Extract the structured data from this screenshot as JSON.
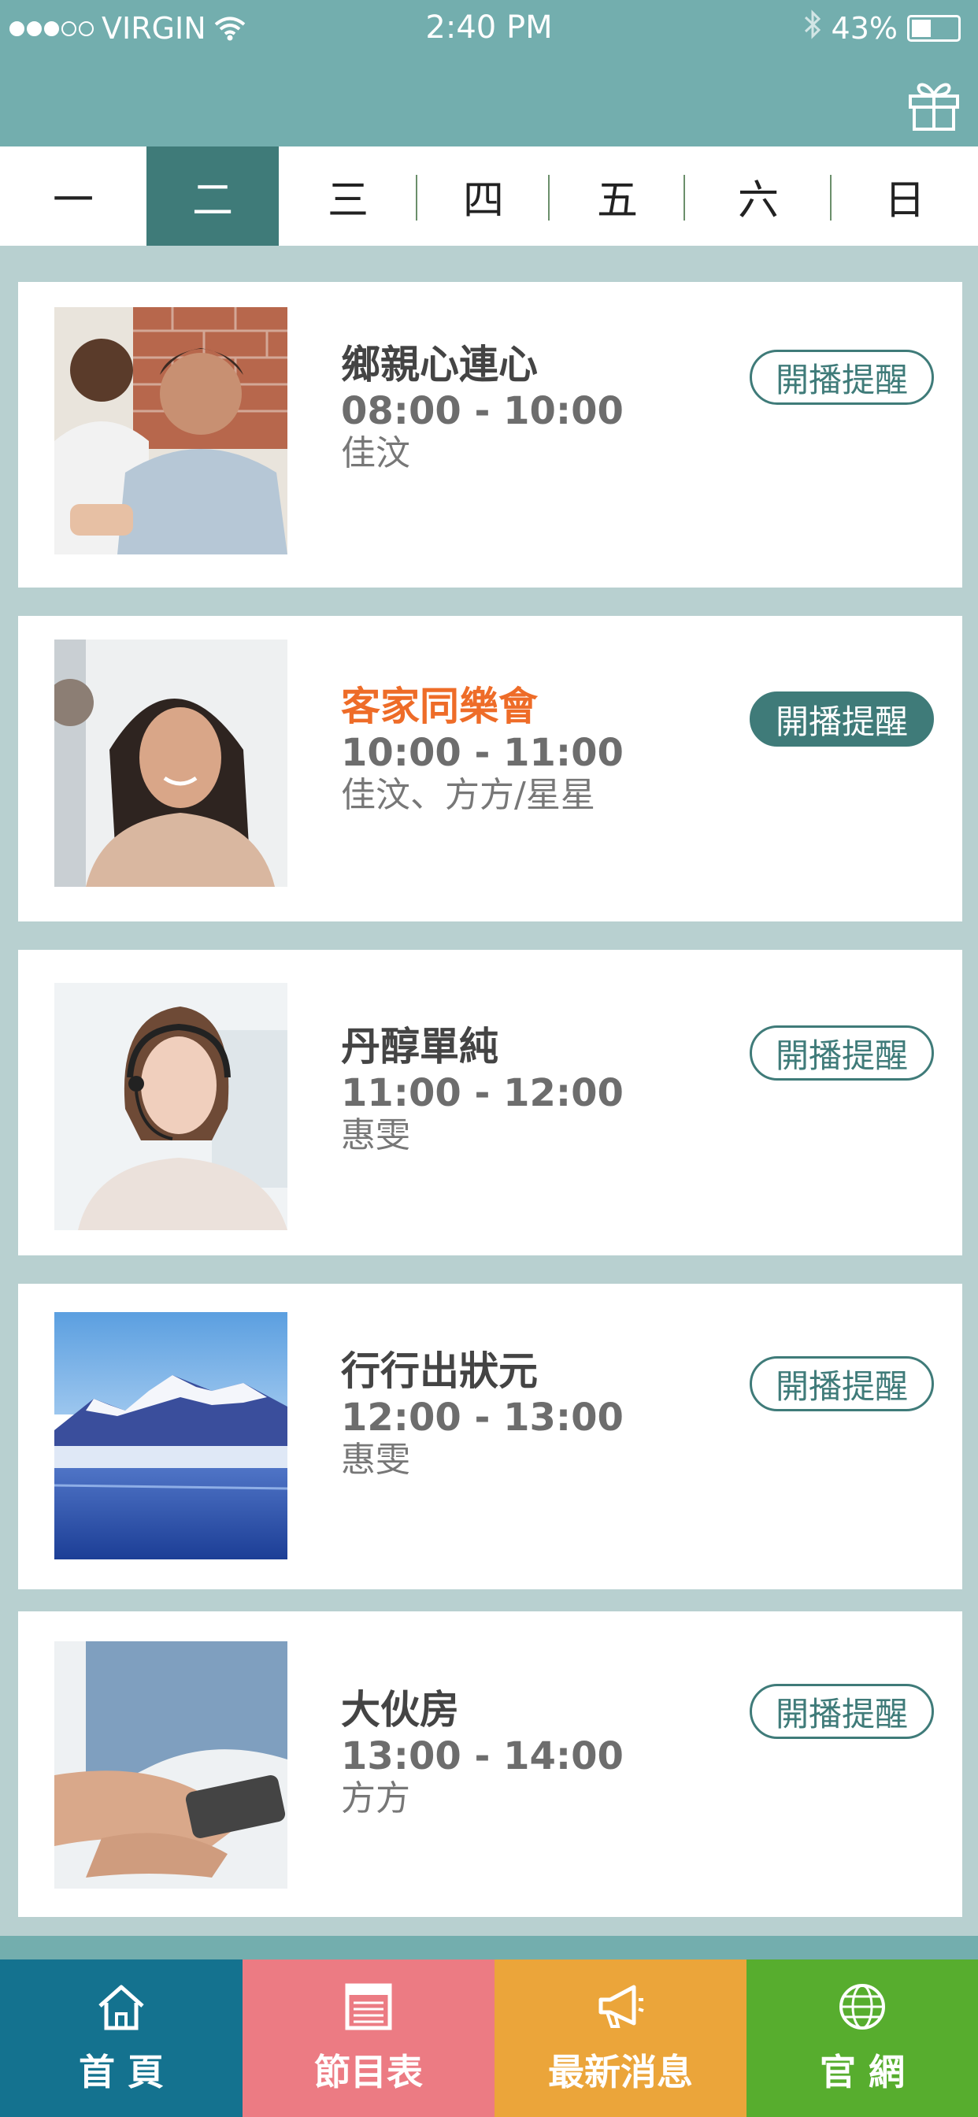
{
  "status_bar": {
    "carrier": "VIRGIN",
    "time": "2:40 PM",
    "battery": "43%",
    "battery_level": 0.43
  },
  "header": {
    "gift_icon": "gift-icon"
  },
  "days": {
    "active_index": 1,
    "items": [
      "一",
      "二",
      "三",
      "四",
      "五",
      "六",
      "日"
    ]
  },
  "programs": [
    {
      "title": "鄉親心連心",
      "time": "08:00 - 10:00",
      "host": "佳汶",
      "remind": "開播提醒",
      "remind_on": false,
      "highlight": false,
      "image": "two-men-office-photo"
    },
    {
      "title": "客家同樂會",
      "time": "10:00 - 11:00",
      "host": "佳汶、方方/星星",
      "remind": "開播提醒",
      "remind_on": true,
      "highlight": true,
      "image": "smiling-woman-photo"
    },
    {
      "title": "丹醇單純",
      "time": "11:00 - 12:00",
      "host": "惠雯",
      "remind": "開播提醒",
      "remind_on": false,
      "highlight": false,
      "image": "headset-woman-photo"
    },
    {
      "title": "行行出狀元",
      "time": "12:00 - 13:00",
      "host": "惠雯",
      "remind": "開播提醒",
      "remind_on": false,
      "highlight": false,
      "image": "snowy-mountain-lake-photo"
    },
    {
      "title": "大伙房",
      "time": "13:00 - 14:00",
      "host": "方方",
      "remind": "開播提醒",
      "remind_on": false,
      "highlight": false,
      "image": "hands-phone-photo"
    }
  ],
  "nav": [
    {
      "label": "首 頁",
      "icon": "home-icon",
      "color": "#14728f"
    },
    {
      "label": "節目表",
      "icon": "schedule-icon",
      "color": "#ec7b83"
    },
    {
      "label": "最新消息",
      "icon": "megaphone-icon",
      "color": "#eba53a"
    },
    {
      "label": "官 網",
      "icon": "globe-icon",
      "color": "#57ad2e"
    }
  ],
  "colors": {
    "header": "#73aeae",
    "accent": "#3f7b79",
    "highlight_title": "#ee6c28",
    "background": "#b8d0d0"
  }
}
